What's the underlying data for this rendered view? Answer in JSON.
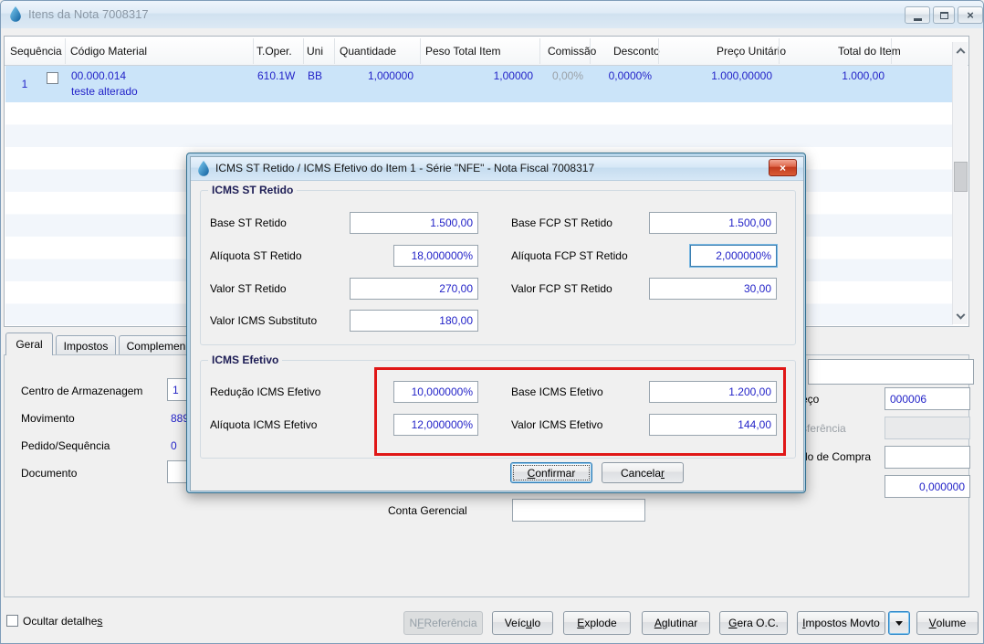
{
  "colors": {
    "accent_red": "#e01717",
    "value_blue": "#2323c8",
    "selection_blue": "#cbe4f9"
  },
  "window": {
    "title": "Itens da Nota 7008317"
  },
  "grid": {
    "columns": [
      {
        "label": "Sequência"
      },
      {
        "label": "Código Material"
      },
      {
        "label": "T.Oper."
      },
      {
        "label": "Uni"
      },
      {
        "label": "Quantidade"
      },
      {
        "label": "Peso Total Item"
      },
      {
        "label": "Comissão"
      },
      {
        "label": "Desconto"
      },
      {
        "label": "Preço Unitário"
      },
      {
        "label": "Total do Item"
      }
    ],
    "row": {
      "seq": "1",
      "codigo": "00.000.014",
      "descricao": "teste alterado",
      "toper": "610.1W",
      "uni": "BB",
      "quantidade": "1,000000",
      "peso_total": "1,00000",
      "comissao": "0,00%",
      "desconto": "0,0000%",
      "preco_unitario": "1.000,00000",
      "total_item": "1.000,00"
    }
  },
  "tabs": {
    "geral": "Geral",
    "impostos": "Impostos",
    "complemento": "Complemen"
  },
  "detail": {
    "centro_armazenagem": {
      "label": "Centro de Armazenagem",
      "value": "1"
    },
    "movimento": {
      "label": "Movimento",
      "value": "889"
    },
    "pedido_sequencia": {
      "label": "Pedido/Sequência",
      "value": "0"
    },
    "documento": {
      "label": "Documento",
      "value": ""
    },
    "conta_gerencial": {
      "label": "Conta Gerencial",
      "value": ""
    },
    "right_partial": {
      "preco": {
        "label": "eço",
        "value": "000006"
      },
      "transferencia": {
        "label": "sferência",
        "value": ""
      },
      "pedido_compra": {
        "label": "do de Compra",
        "value": ""
      },
      "quantidade": {
        "value": "0,000000"
      }
    }
  },
  "dialog": {
    "title": "ICMS ST Retido / ICMS Efetivo do Item 1 - Série \"NFE\" - Nota Fiscal 7008317",
    "groups": {
      "st_retido": {
        "title": "ICMS ST Retido",
        "base_st": {
          "label": "Base ST Retido",
          "value": "1.500,00"
        },
        "base_fcp_st": {
          "label": "Base FCP ST Retido",
          "value": "1.500,00"
        },
        "aliquota_st": {
          "label": "Alíquota ST Retido",
          "value": "18,000000%"
        },
        "aliquota_fcp_st": {
          "label": "Alíquota FCP ST Retido",
          "value": "2,000000%"
        },
        "valor_st": {
          "label": "Valor ST Retido",
          "value": "270,00"
        },
        "valor_fcp_st": {
          "label": "Valor FCP ST Retido",
          "value": "30,00"
        },
        "valor_icms_substituto": {
          "label": "Valor ICMS Substituto",
          "value": "180,00"
        }
      },
      "efetivo": {
        "title": "ICMS Efetivo",
        "reducao": {
          "label": "Redução ICMS Efetivo",
          "value": "10,000000%"
        },
        "base": {
          "label": "Base ICMS Efetivo",
          "value": "1.200,00"
        },
        "aliquota": {
          "label": "Alíquota ICMS Efetivo",
          "value": "12,000000%"
        },
        "valor": {
          "label": "Valor ICMS Efetivo",
          "value": "144,00"
        }
      }
    },
    "buttons": {
      "confirmar": {
        "text": "Confirmar",
        "u": 0
      },
      "cancelar": {
        "text": "Cancelar",
        "u": 7
      }
    }
  },
  "footer": {
    "ocultar_detalhes": {
      "text": "Ocultar detalhes",
      "u": 15
    },
    "nf_referencia": {
      "text": "NF Referência",
      "u": 1
    },
    "veiculo": {
      "text": "Veículo",
      "u": 4
    },
    "explode": {
      "text": "Explode",
      "u": 0
    },
    "aglutinar": {
      "text": "Aglutinar",
      "u": 0
    },
    "gera_oc": {
      "text": "Gera O.C.",
      "u": 0
    },
    "impostos_movto": {
      "text": "Impostos Movto",
      "u": 0
    },
    "volume": {
      "text": "Volume",
      "u": 0
    }
  }
}
